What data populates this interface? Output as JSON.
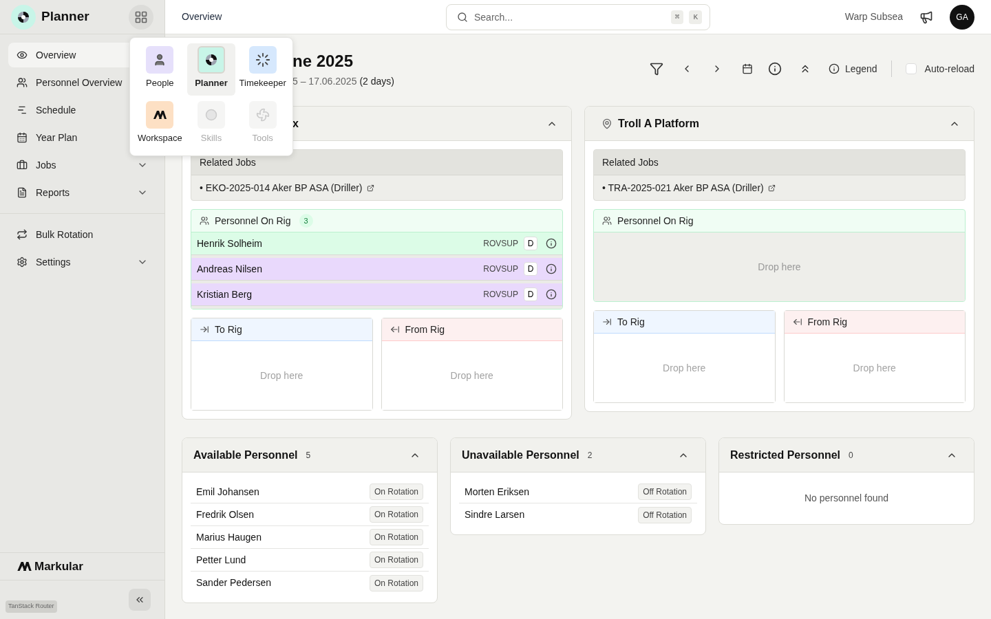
{
  "sidebar": {
    "app_name": "Planner",
    "nav": [
      {
        "label": "Overview",
        "selected": true
      },
      {
        "label": "Personnel Overview",
        "selected": false
      },
      {
        "label": "Schedule",
        "selected": false
      },
      {
        "label": "Year Plan",
        "selected": false
      },
      {
        "label": "Jobs",
        "selected": false,
        "expandable": true
      },
      {
        "label": "Reports",
        "selected": false,
        "expandable": true
      }
    ],
    "secondary": [
      {
        "label": "Bulk Rotation",
        "selected": false,
        "expandable": false
      },
      {
        "label": "Settings",
        "selected": false,
        "expandable": true
      }
    ],
    "brand": "Markular",
    "devtools": "TanStack Router"
  },
  "app_switcher": [
    {
      "label": "People",
      "kind": "people",
      "selected": false,
      "disabled": false
    },
    {
      "label": "Planner",
      "kind": "planner",
      "selected": true,
      "disabled": false
    },
    {
      "label": "Timekeeper",
      "kind": "timekeeper",
      "selected": false,
      "disabled": false
    },
    {
      "label": "Workspace",
      "kind": "workspace",
      "selected": false,
      "disabled": false
    },
    {
      "label": "Skills",
      "kind": "skills",
      "selected": false,
      "disabled": true
    },
    {
      "label": "Tools",
      "kind": "tools",
      "selected": false,
      "disabled": true
    }
  ],
  "topbar": {
    "page_title": "Overview",
    "search": {
      "placeholder": "Search..."
    },
    "shortcut": [
      "⌘",
      "K"
    ],
    "organization": "Warp Subsea",
    "avatar": "GA"
  },
  "header": {
    "title": "ne 2025",
    "dates": "5 – 17.06.2025",
    "duration": "(2 days)",
    "legend": "Legend",
    "auto_reload": {
      "label": "Auto-reload",
      "checked": false
    }
  },
  "rigs": [
    {
      "title": "x",
      "related_jobs": {
        "heading": "Related Jobs",
        "jobs": [
          "• EKO-2025-014 Aker BP ASA (Driller)"
        ]
      },
      "personnel_heading": "Personnel On Rig",
      "count": "3",
      "personnel": [
        {
          "name": "Henrik Solheim",
          "role": "ROVSUP",
          "shift": "D",
          "color": "#dcfce7"
        },
        {
          "name": "Andreas Nilsen",
          "role": "ROVSUP",
          "shift": "D",
          "color": "#e9d9fc"
        },
        {
          "name": "Kristian Berg",
          "role": "ROVSUP",
          "shift": "D",
          "color": "#e9d9fc"
        }
      ],
      "to_rig": {
        "label": "To Rig",
        "placeholder": "Drop here"
      },
      "from_rig": {
        "label": "From Rig",
        "placeholder": "Drop here"
      }
    },
    {
      "title": "Troll A Platform",
      "related_jobs": {
        "heading": "Related Jobs",
        "jobs": [
          "• TRA-2025-021 Aker BP ASA (Driller)"
        ]
      },
      "personnel_heading": "Personnel On Rig",
      "empty": "Drop here",
      "to_rig": {
        "label": "To Rig",
        "placeholder": "Drop here"
      },
      "from_rig": {
        "label": "From Rig",
        "placeholder": "Drop here"
      }
    }
  ],
  "panels": [
    {
      "title": "Available Personnel",
      "count": "5",
      "people": [
        {
          "name": "Emil Johansen",
          "status": "On Rotation"
        },
        {
          "name": "Fredrik Olsen",
          "status": "On Rotation"
        },
        {
          "name": "Marius Haugen",
          "status": "On Rotation"
        },
        {
          "name": "Petter Lund",
          "status": "On Rotation"
        },
        {
          "name": "Sander Pedersen",
          "status": "On Rotation"
        }
      ]
    },
    {
      "title": "Unavailable Personnel",
      "count": "2",
      "people": [
        {
          "name": "Morten Eriksen",
          "status": "Off Rotation"
        },
        {
          "name": "Sindre Larsen",
          "status": "Off Rotation"
        }
      ]
    },
    {
      "title": "Restricted Personnel",
      "count": "0",
      "empty": "No personnel found"
    }
  ]
}
